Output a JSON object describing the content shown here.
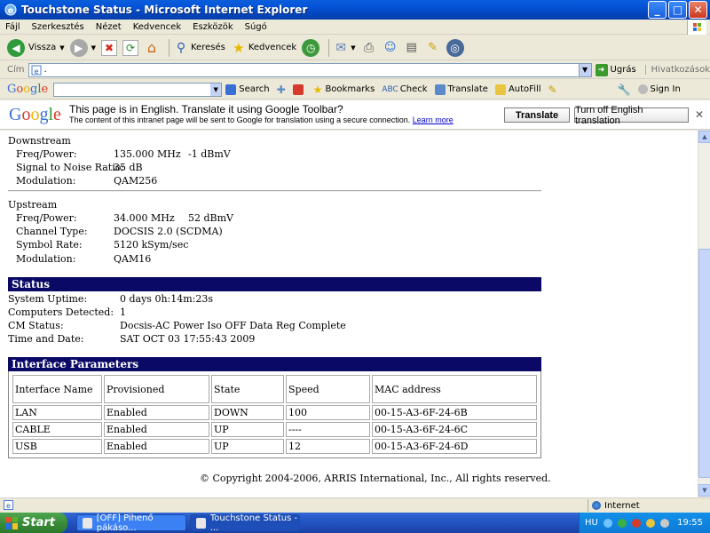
{
  "window": {
    "title": "Touchstone Status - Microsoft Internet Explorer",
    "minimize": "_",
    "maximize": "□",
    "close": "✕"
  },
  "menu": [
    "Fájl",
    "Szerkesztés",
    "Nézet",
    "Kedvencek",
    "Eszközök",
    "Súgó"
  ],
  "toolbar": {
    "back_label": "Vissza",
    "search_label": "Keresés",
    "favorites_label": "Kedvencek"
  },
  "address": {
    "label": "Cím",
    "value": ".",
    "go_label": "Ugrás",
    "links_label": "Hivatkozások"
  },
  "google_toolbar": {
    "logo": "Google",
    "search_label": "Search",
    "bookmarks_label": "Bookmarks",
    "check_label": "Check",
    "translate_label": "Translate",
    "autofill_label": "AutoFill",
    "signin_label": "Sign In"
  },
  "translate_bar": {
    "logo": "Google",
    "message": "This page is in English.  Translate it using Google Toolbar?",
    "note": "The content of this intranet page will be sent to Google for translation using a secure connection.",
    "learn_more": "Learn more",
    "translate_button": "Translate",
    "turn_off_button": "Turn off English translation",
    "close": "✕"
  },
  "downstream": {
    "heading": "Downstream",
    "freq_label": "Freq/Power:",
    "freq_value": "135.000 MHz",
    "power_value": "-1 dBmV",
    "snr_label": "Signal to Noise Ratio:",
    "snr_value": "35 dB",
    "mod_label": "Modulation:",
    "mod_value": "QAM256"
  },
  "upstream": {
    "heading": "Upstream",
    "freq_label": "Freq/Power:",
    "freq_value": "34.000 MHz",
    "power_value": "52 dBmV",
    "channel_label": "Channel Type:",
    "channel_value": "DOCSIS 2.0 (SCDMA)",
    "symbol_label": "Symbol Rate:",
    "symbol_value": "5120 kSym/sec",
    "mod_label": "Modulation:",
    "mod_value": "QAM16"
  },
  "status": {
    "heading": "Status",
    "uptime_label": "System Uptime:",
    "uptime_value": "0 days 0h:14m:23s",
    "computers_label": "Computers Detected:",
    "computers_value": "1",
    "cm_label": "CM Status:",
    "cm_value": "Docsis-AC Power Iso OFF Data Reg Complete",
    "time_label": "Time and Date:",
    "time_value": "SAT OCT 03 17:55:43 2009"
  },
  "interface": {
    "heading": "Interface Parameters",
    "columns": [
      "Interface Name",
      "Provisioned",
      "State",
      "Speed",
      "MAC address"
    ],
    "rows": [
      [
        "LAN",
        "Enabled",
        "DOWN",
        "100",
        "00-15-A3-6F-24-6B"
      ],
      [
        "CABLE",
        "Enabled",
        "UP",
        "----",
        "00-15-A3-6F-24-6C"
      ],
      [
        "USB",
        "Enabled",
        "UP",
        "12",
        "00-15-A3-6F-24-6D"
      ]
    ]
  },
  "copyright": "© Copyright 2004-2006, ARRIS International, Inc., All rights reserved.",
  "statusbar": {
    "zone": "Internet"
  },
  "taskbar": {
    "start": "Start",
    "items": [
      "[OFF] Pihenő pákáso...",
      "Touchstone Status - ..."
    ],
    "lang": "HU",
    "clock": "19:55"
  }
}
